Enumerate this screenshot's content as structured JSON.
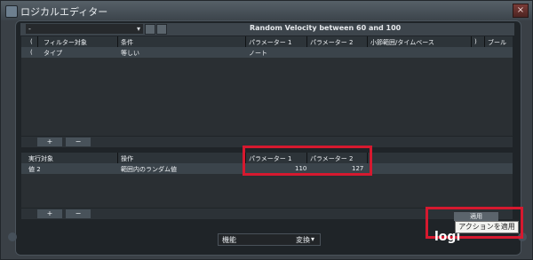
{
  "window": {
    "title": "ロジカルエディター",
    "close_label": "×"
  },
  "preset": {
    "value": "-",
    "name": "Random Velocity between 60 and 100"
  },
  "filter_table": {
    "headers": [
      "(",
      "フィルター対象",
      "条件",
      "パラメーター 1",
      "パラメーター 2",
      "小節範囲/タイムベース",
      ")",
      "ブール"
    ],
    "row": [
      "(",
      "タイプ",
      "等しい",
      "ノート"
    ]
  },
  "action_table": {
    "headers": [
      "実行対象",
      "操作",
      "パラメーター 1",
      "パラメーター 2"
    ],
    "row": {
      "target": "値 2",
      "operation": "範囲内のランダム値",
      "p1": "110",
      "p2": "127"
    }
  },
  "buttons": {
    "add": "+",
    "remove": "−",
    "apply": "適用"
  },
  "tooltip": "アクションを適用",
  "footer": {
    "function_label": "機能",
    "mode": "変換",
    "logo": "logi"
  }
}
